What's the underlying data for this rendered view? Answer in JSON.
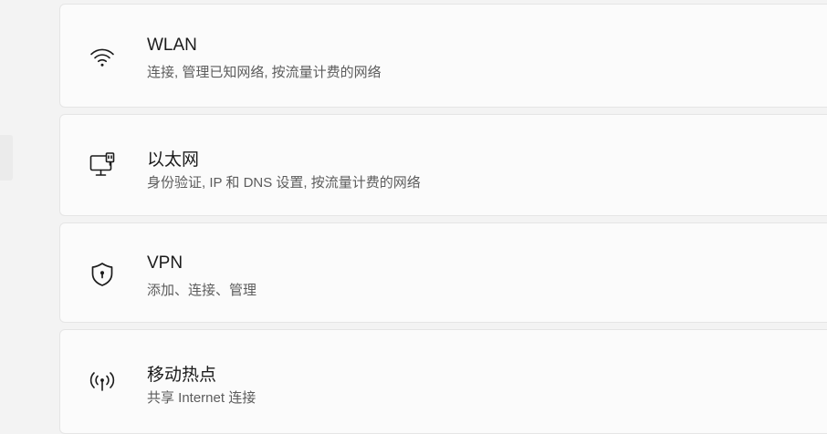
{
  "items": [
    {
      "title": "WLAN",
      "subtitle": "连接, 管理已知网络, 按流量计费的网络",
      "icon": "wifi-icon"
    },
    {
      "title": "以太网",
      "subtitle": "身份验证, IP 和 DNS 设置, 按流量计费的网络",
      "icon": "ethernet-icon"
    },
    {
      "title": "VPN",
      "subtitle": "添加、连接、管理",
      "icon": "vpn-shield-icon"
    },
    {
      "title": "移动热点",
      "subtitle": "共享 Internet 连接",
      "icon": "hotspot-icon"
    }
  ]
}
